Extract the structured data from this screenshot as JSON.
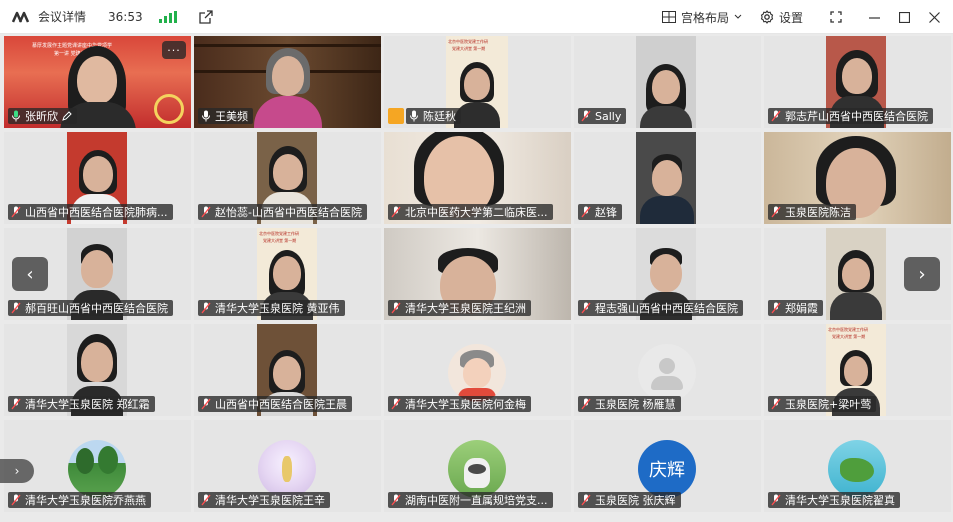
{
  "titlebar": {
    "app_title": "会议详情",
    "timer": "36:53",
    "layout_label": "宫格布局",
    "settings_label": "设置"
  },
  "tiles": [
    {
      "name": "张昕欣"
    },
    {
      "name": "王美频"
    },
    {
      "name": "陈廷秋"
    },
    {
      "name": "Sally"
    },
    {
      "name": "郭志芹山西省中西医结合医院"
    },
    {
      "name": "山西省中西医结合医院肺病..."
    },
    {
      "name": "赵怡蕊-山西省中西医结合医院"
    },
    {
      "name": "北京中医药大学第二临床医..."
    },
    {
      "name": "赵锋"
    },
    {
      "name": "玉泉医院陈洁"
    },
    {
      "name": "郝百旺山西省中西医结合医院"
    },
    {
      "name": "清华大学玉泉医院 黄亚伟"
    },
    {
      "name": "清华大学玉泉医院王纪洲"
    },
    {
      "name": "程志强山西省中西医结合医院"
    },
    {
      "name": "郑娟霞"
    },
    {
      "name": "清华大学玉泉医院 郑红霜"
    },
    {
      "name": "山西省中西医结合医院王晨"
    },
    {
      "name": "清华大学玉泉医院何金梅"
    },
    {
      "name": "玉泉医院 杨雁慧"
    },
    {
      "name": "玉泉医院+梁叶莺"
    },
    {
      "name": "清华大学玉泉医院乔燕燕"
    },
    {
      "name": "清华大学玉泉医院王辛"
    },
    {
      "name": "湖南中医附一直属规培党支..."
    },
    {
      "name": "玉泉医院 张庆辉"
    },
    {
      "name": "清华大学玉泉医院翟真"
    }
  ],
  "tile1_overlay": {
    "poster_line1": "慕厚发展作主题党课讲座中华党项学",
    "poster_line2": "第一讲 党建为基安",
    "more": "···"
  },
  "tile3_overlay": {
    "poster_line1": "北京中医院党建工作研",
    "poster_line2": "党建大讲堂 第一期"
  },
  "tile12_overlay": {
    "poster_line1": "北京中医院党建工作研",
    "poster_line2": "党建大讲堂 第一期"
  },
  "tile20_overlay": {
    "poster_line1": "北京中医院党建工作研",
    "poster_line2": "党建大讲堂 第一期"
  },
  "avatar_text_24": "庆辉",
  "nav": {
    "prev": "‹",
    "next": "›",
    "side": "›"
  },
  "colors": {
    "active_border": "#2fbf71",
    "signal": "#22b14c",
    "host_badge": "#f5a623"
  }
}
